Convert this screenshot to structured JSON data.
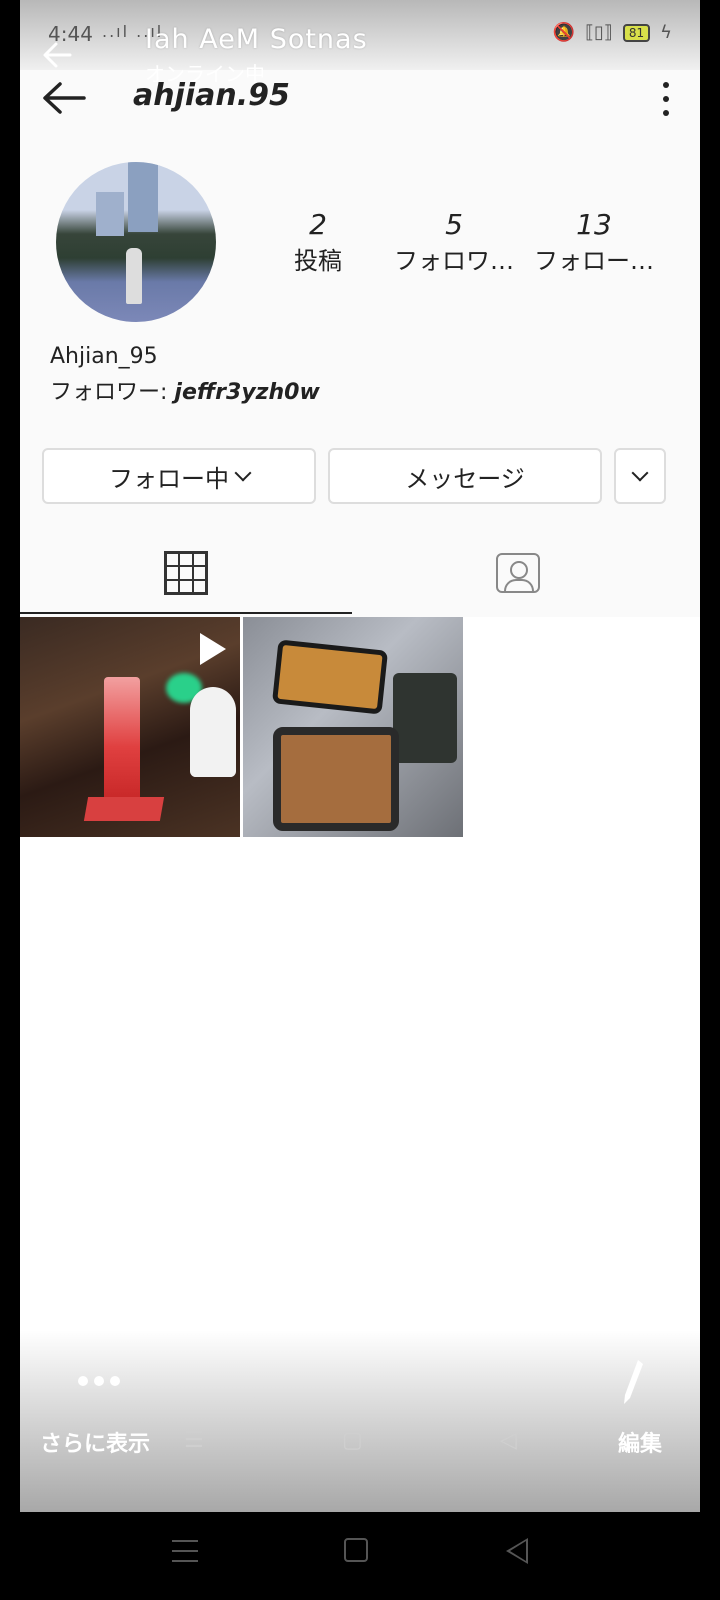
{
  "status_bar": {
    "time": "4:44",
    "signal": "..ıl ..ıl",
    "battery": "81"
  },
  "viewer": {
    "title": "Iah AeM Sotnas",
    "subtitle": "オンライン中",
    "show_more_label": "さらに表示",
    "edit_label": "編集"
  },
  "profile": {
    "username": "ahjian.95",
    "display_name": "Ahjian_95",
    "followed_by_prefix": "フォロワー: ",
    "followed_by_user": "jeffr3yzh0w"
  },
  "stats": [
    {
      "value": "2",
      "label": "投稿"
    },
    {
      "value": "5",
      "label": "フォロワ…"
    },
    {
      "value": "13",
      "label": "フォロー…"
    }
  ],
  "buttons": {
    "following_label": "フォロー中",
    "message_label": "メッセージ"
  },
  "tabs": [
    {
      "icon": "grid-icon",
      "active": true
    },
    {
      "icon": "tagged-person-icon",
      "active": false
    }
  ],
  "posts": [
    {
      "type": "video",
      "icon": "play-icon"
    },
    {
      "type": "photo"
    }
  ]
}
